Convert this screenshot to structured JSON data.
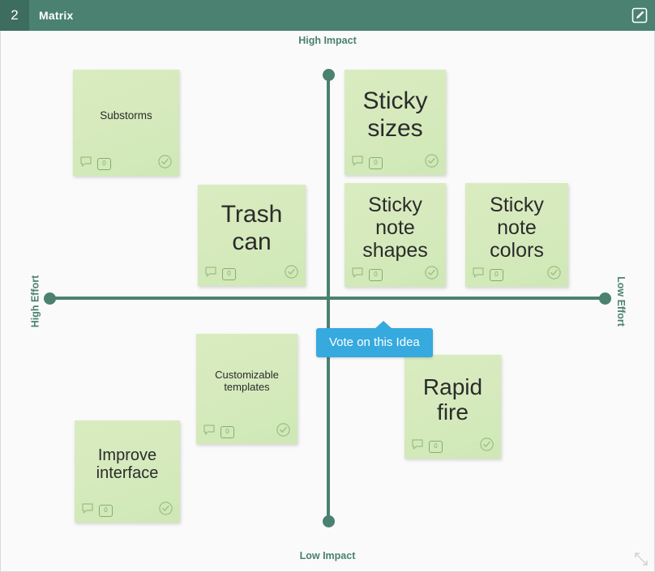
{
  "header": {
    "index": "2",
    "title": "Matrix",
    "edit_icon": "edit-square-pencil-icon"
  },
  "axes": {
    "top_label": "High Impact",
    "bottom_label": "Low Impact",
    "left_label": "High Effort",
    "right_label": "Low Effort",
    "line_color": "#4a8170"
  },
  "tooltip": {
    "text": "Vote on this Idea",
    "color": "#36a9df"
  },
  "sticky_icons": {
    "comment": "comment-bubble-icon",
    "votes": "vote-count-badge",
    "check": "check-circle-icon"
  },
  "notes": [
    {
      "id": "substorms",
      "text": "Substorms",
      "votes": "0",
      "size": "sm"
    },
    {
      "id": "sticky-sizes",
      "text": "Sticky sizes",
      "votes": "0",
      "size": "lg"
    },
    {
      "id": "trash-can",
      "text": "Trash can",
      "votes": "0",
      "size": "lg"
    },
    {
      "id": "note-shapes",
      "text": "Sticky note shapes",
      "votes": "0",
      "size": "md"
    },
    {
      "id": "note-colors",
      "text": "Sticky note colors",
      "votes": "0",
      "size": "md"
    },
    {
      "id": "custom-tpl",
      "text": "Customizable templates",
      "votes": "0",
      "size": "xs"
    },
    {
      "id": "rapid-fire",
      "text": "Rapid fire",
      "votes": "0",
      "size": "lg"
    },
    {
      "id": "improve-ui",
      "text": "Improve interface",
      "votes": "0",
      "size": "sm"
    }
  ],
  "footer": {
    "resize_icon": "resize-corner-icon"
  }
}
